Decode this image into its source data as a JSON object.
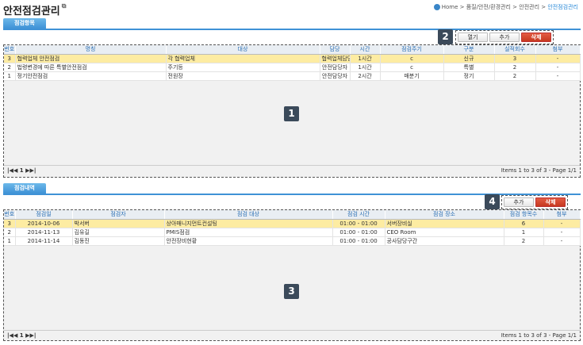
{
  "page": {
    "title": "안전점검관리"
  },
  "breadcrumb": {
    "home": "Home",
    "path": " > 품질/안전/환경관리 > 안전관리 > ",
    "current": "안전점검관리"
  },
  "section1": {
    "tab": "점검항목",
    "buttons": {
      "open": "열기",
      "add": "추가",
      "delete": "삭제"
    },
    "columns": [
      "번호",
      "명칭",
      "대상",
      "담당",
      "시간",
      "점검주기",
      "구분",
      "실적회수",
      "첨부"
    ],
    "rows": [
      [
        "3",
        "협력업체 안전점검",
        "각 협력업체",
        "협력업체담당",
        "1시간",
        "c",
        "신규",
        "3",
        "-"
      ],
      [
        "2",
        "법령변경에 따른 특별안전점검",
        "주기등",
        "안전담당자",
        "1시간",
        "c",
        "특별",
        "2",
        "-"
      ],
      [
        "1",
        "정기안전점검",
        "전원장",
        "안전담당자",
        "2시간",
        "매분기",
        "정기",
        "2",
        "-"
      ]
    ],
    "pager": {
      "nav": "|◀◀ 1 ▶▶|",
      "info": "Items 1 to 3 of 3 - Page 1/1"
    },
    "badge_table": "1",
    "badge_buttons": "2"
  },
  "section2": {
    "tab": "점검내역",
    "buttons": {
      "add": "추가",
      "delete": "삭제"
    },
    "columns": [
      "번호",
      "점검일",
      "점검자",
      "점검 대상",
      "점검 시간",
      "점검 장소",
      "점검 항목수",
      "첨부"
    ],
    "rows": [
      [
        "3",
        "2014-10-06",
        "박서버",
        "상아매니지먼트컨설팅",
        "01:00 - 01:00",
        "서버장비실",
        "6",
        "-"
      ],
      [
        "2",
        "2014-11-13",
        "김유길",
        "PMIS점검",
        "01:00 - 01:00",
        "CEO Room",
        "1",
        "-"
      ],
      [
        "1",
        "2014-11-14",
        "김동진",
        "안전장비현황",
        "01:00 - 01:00",
        "공사담당구간",
        "2",
        "-"
      ]
    ],
    "pager": {
      "nav": "|◀◀ 1 ▶▶|",
      "info": "Items 1 to 3 of 3 - Page 1/1"
    },
    "badge_table": "3",
    "badge_buttons": "4"
  }
}
